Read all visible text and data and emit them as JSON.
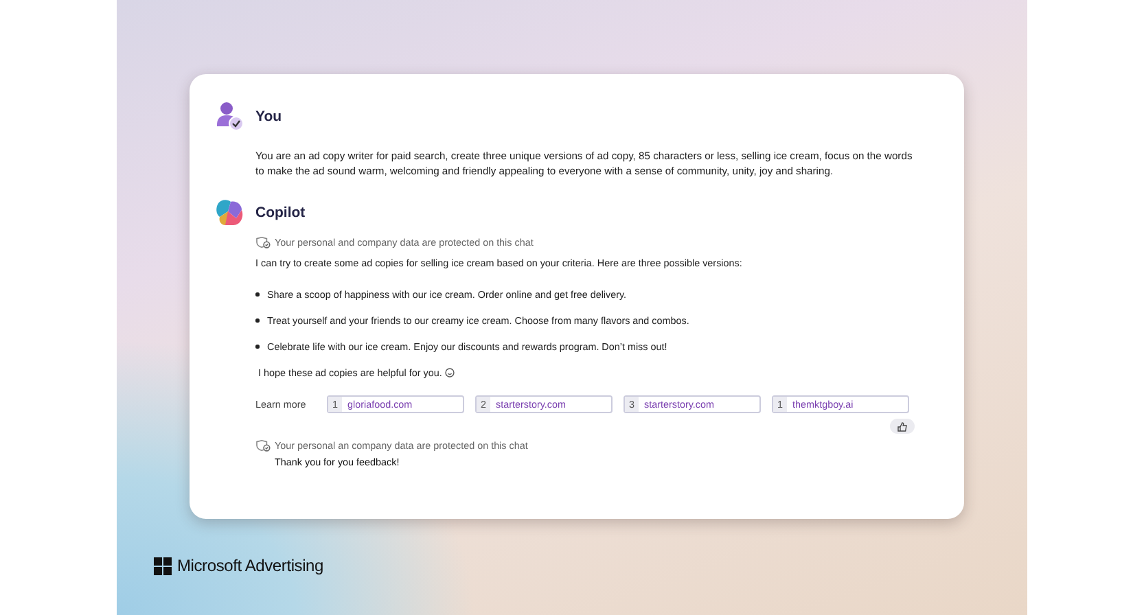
{
  "user_message": {
    "author": "You",
    "text": "You are an ad copy writer for paid search, create three unique versions of ad copy, 85 characters or less, selling ice cream, focus on the words to make the ad sound warm, welcoming and friendly appealing to everyone with a sense of community, unity, joy and sharing."
  },
  "copilot_message": {
    "author": "Copilot",
    "notice": "Your personal and company data are protected on this chat",
    "intro": "I can try to create some ad copies for selling ice cream based on your criteria. Here are three possible versions:",
    "bullets": [
      "Share a scoop of happiness with our ice cream. Order online and get free delivery.",
      "Treat yourself and your friends to our creamy ice cream. Choose from many flavors and combos.",
      "Celebrate life with our ice cream. Enjoy our discounts and rewards program. Don’t miss out!"
    ],
    "closing": "I hope these ad copies are helpful for you.",
    "learn_more": {
      "label": "Learn more",
      "links": [
        {
          "index": "1",
          "domain": "gloriafood.com"
        },
        {
          "index": "2",
          "domain": "starterstory.com"
        },
        {
          "index": "3",
          "domain": "starterstory.com"
        },
        {
          "index": "1",
          "domain": "themktgboy.ai"
        }
      ]
    },
    "footer_notice": "Your personal an company data are protected on this chat",
    "feedback": "Thank you for you feedback!"
  },
  "brand": {
    "name": "Microsoft Advertising"
  }
}
